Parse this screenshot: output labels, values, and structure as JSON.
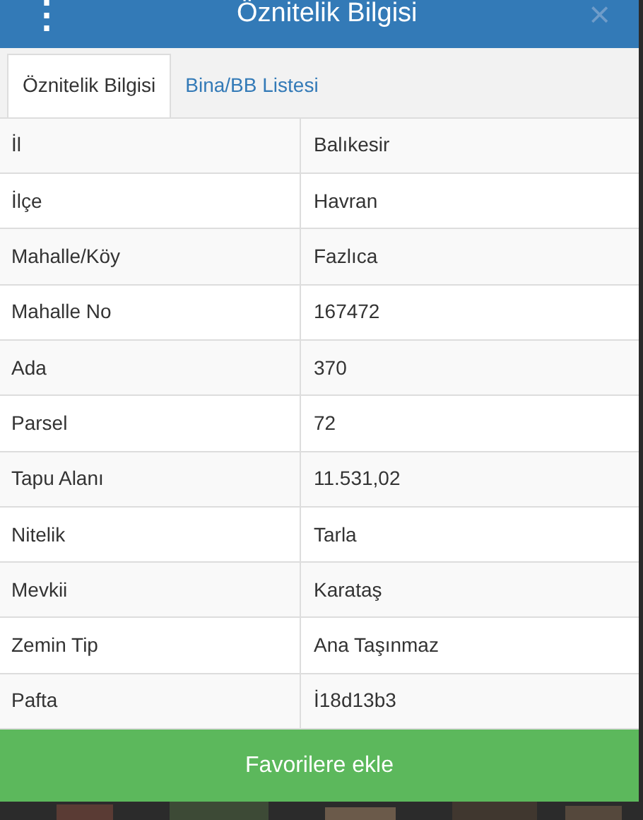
{
  "header": {
    "menu_icon": "⋮",
    "title": "Öznitelik Bilgisi",
    "close": "×"
  },
  "tabs": [
    {
      "label": "Öznitelik Bilgisi",
      "selected": true
    },
    {
      "label": "Bina/BB Listesi",
      "selected": false
    }
  ],
  "table": {
    "rows": [
      {
        "label": "İl",
        "value": "Balıkesir"
      },
      {
        "label": "İlçe",
        "value": "Havran"
      },
      {
        "label": "Mahalle/Köy",
        "value": "Fazlıca"
      },
      {
        "label": "Mahalle No",
        "value": "167472"
      },
      {
        "label": "Ada",
        "value": "370"
      },
      {
        "label": "Parsel",
        "value": "72"
      },
      {
        "label": "Tapu Alanı",
        "value": "11.531,02"
      },
      {
        "label": "Nitelik",
        "value": "Tarla"
      },
      {
        "label": "Mevkii",
        "value": "Karataş"
      },
      {
        "label": "Zemin Tip",
        "value": "Ana Taşınmaz"
      },
      {
        "label": "Pafta",
        "value": "İ18d13b3"
      }
    ]
  },
  "button": {
    "label": "Favorilere ekle"
  }
}
